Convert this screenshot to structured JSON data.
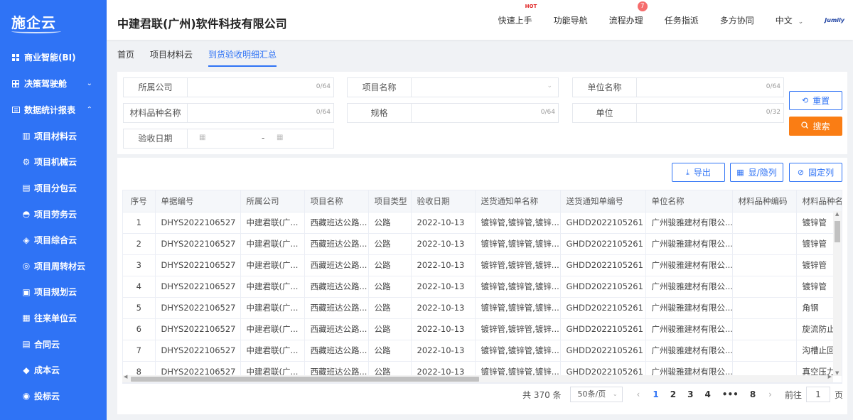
{
  "sidebar": {
    "logo": "施企云",
    "items": [
      {
        "label": "商业智能(BI)",
        "icon": "grid-icon"
      },
      {
        "label": "决策驾驶舱",
        "icon": "dashboard-icon",
        "chevron": "⌄"
      },
      {
        "label": "数据统计报表",
        "icon": "report-icon",
        "chevron": "⌃"
      }
    ],
    "subitems": [
      {
        "label": "项目材料云",
        "icon": "building-icon"
      },
      {
        "label": "项目机械云",
        "icon": "gear-icon"
      },
      {
        "label": "项目分包云",
        "icon": "folder-icon"
      },
      {
        "label": "项目劳务云",
        "icon": "helmet-icon"
      },
      {
        "label": "项目综合云",
        "icon": "layers-icon"
      },
      {
        "label": "项目周转材云",
        "icon": "cycle-icon"
      },
      {
        "label": "项目规划云",
        "icon": "plan-icon"
      },
      {
        "label": "往来单位云",
        "icon": "office-icon"
      },
      {
        "label": "合同云",
        "icon": "contract-icon"
      },
      {
        "label": "成本云",
        "icon": "cost-icon"
      },
      {
        "label": "投标云",
        "icon": "bid-icon"
      }
    ]
  },
  "header": {
    "company": "中建君联(广州)软件科技有限公司",
    "nav": {
      "quick_start": "快速上手",
      "hot": "HOT",
      "function_nav": "功能导航",
      "process": "流程办理",
      "process_badge": "7",
      "tasks": "任务指派",
      "collab": "多方协同",
      "lang": "中文",
      "brand": "Jumily"
    }
  },
  "tabs": [
    "首页",
    "项目材料云",
    "到货验收明细汇总"
  ],
  "search": {
    "company": {
      "label": "所属公司",
      "count": "0/64"
    },
    "project": {
      "label": "项目名称"
    },
    "unit": {
      "label": "单位名称",
      "count": "0/64"
    },
    "material": {
      "label": "材料品种名称",
      "count": "0/64"
    },
    "spec": {
      "label": "规格",
      "count": "0/64"
    },
    "measure": {
      "label": "单位",
      "count": "0/32"
    },
    "date": {
      "label": "验收日期",
      "separator": "-"
    },
    "reset": "重置",
    "query": "搜索"
  },
  "toolbar": {
    "export": "导出",
    "toggle_columns": "显/隐列",
    "fix_columns": "固定列"
  },
  "table": {
    "headers": [
      "序号",
      "单据编号",
      "所属公司",
      "项目名称",
      "项目类型",
      "验收日期",
      "送货通知单名称",
      "送货通知单编号",
      "单位名称",
      "材料品种编码",
      "材料品种名称"
    ],
    "rows": [
      [
        "1",
        "DHYS2022106527",
        "中建君联(广...",
        "西藏班达公路...",
        "公路",
        "2022-10-13",
        "镀锌管,镀锌管,镀锌...",
        "GHDD2022105261",
        "广州骏雅建材有限公...",
        "",
        "镀锌管"
      ],
      [
        "2",
        "DHYS2022106527",
        "中建君联(广...",
        "西藏班达公路...",
        "公路",
        "2022-10-13",
        "镀锌管,镀锌管,镀锌...",
        "GHDD2022105261",
        "广州骏雅建材有限公...",
        "",
        "镀锌管"
      ],
      [
        "3",
        "DHYS2022106527",
        "中建君联(广...",
        "西藏班达公路...",
        "公路",
        "2022-10-13",
        "镀锌管,镀锌管,镀锌...",
        "GHDD2022105261",
        "广州骏雅建材有限公...",
        "",
        "镀锌管"
      ],
      [
        "4",
        "DHYS2022106527",
        "中建君联(广...",
        "西藏班达公路...",
        "公路",
        "2022-10-13",
        "镀锌管,镀锌管,镀锌...",
        "GHDD2022105261",
        "广州骏雅建材有限公...",
        "",
        "镀锌管"
      ],
      [
        "5",
        "DHYS2022106527",
        "中建君联(广...",
        "西藏班达公路...",
        "公路",
        "2022-10-13",
        "镀锌管,镀锌管,镀锌...",
        "GHDD2022105261",
        "广州骏雅建材有限公...",
        "",
        "角钢"
      ],
      [
        "6",
        "DHYS2022106527",
        "中建君联(广...",
        "西藏班达公路...",
        "公路",
        "2022-10-13",
        "镀锌管,镀锌管,镀锌...",
        "GHDD2022105261",
        "广州骏雅建材有限公...",
        "",
        "旋流防止器"
      ],
      [
        "7",
        "DHYS2022106527",
        "中建君联(广...",
        "西藏班达公路...",
        "公路",
        "2022-10-13",
        "镀锌管,镀锌管,镀锌...",
        "GHDD2022105261",
        "广州骏雅建材有限公...",
        "",
        "沟槽止回阀"
      ],
      [
        "8",
        "DHYS2022106527",
        "中建君联(广...",
        "西藏班达公路...",
        "公路",
        "2022-10-13",
        "镀锌管,镀锌管,镀锌...",
        "GHDD2022105261",
        "广州骏雅建材有限公...",
        "",
        "真空压力表"
      ]
    ]
  },
  "pagination": {
    "total": "共 370 条",
    "page_size": "50条/页",
    "pages": [
      "1",
      "2",
      "3",
      "4",
      "•••",
      "8"
    ],
    "current": "1",
    "goto_label": "前往",
    "goto_value": "1",
    "page_suffix": "页"
  },
  "colors": {
    "sidebar": "#2f73f5",
    "accent": "#2f73f5",
    "search_button": "#fa7d14"
  }
}
